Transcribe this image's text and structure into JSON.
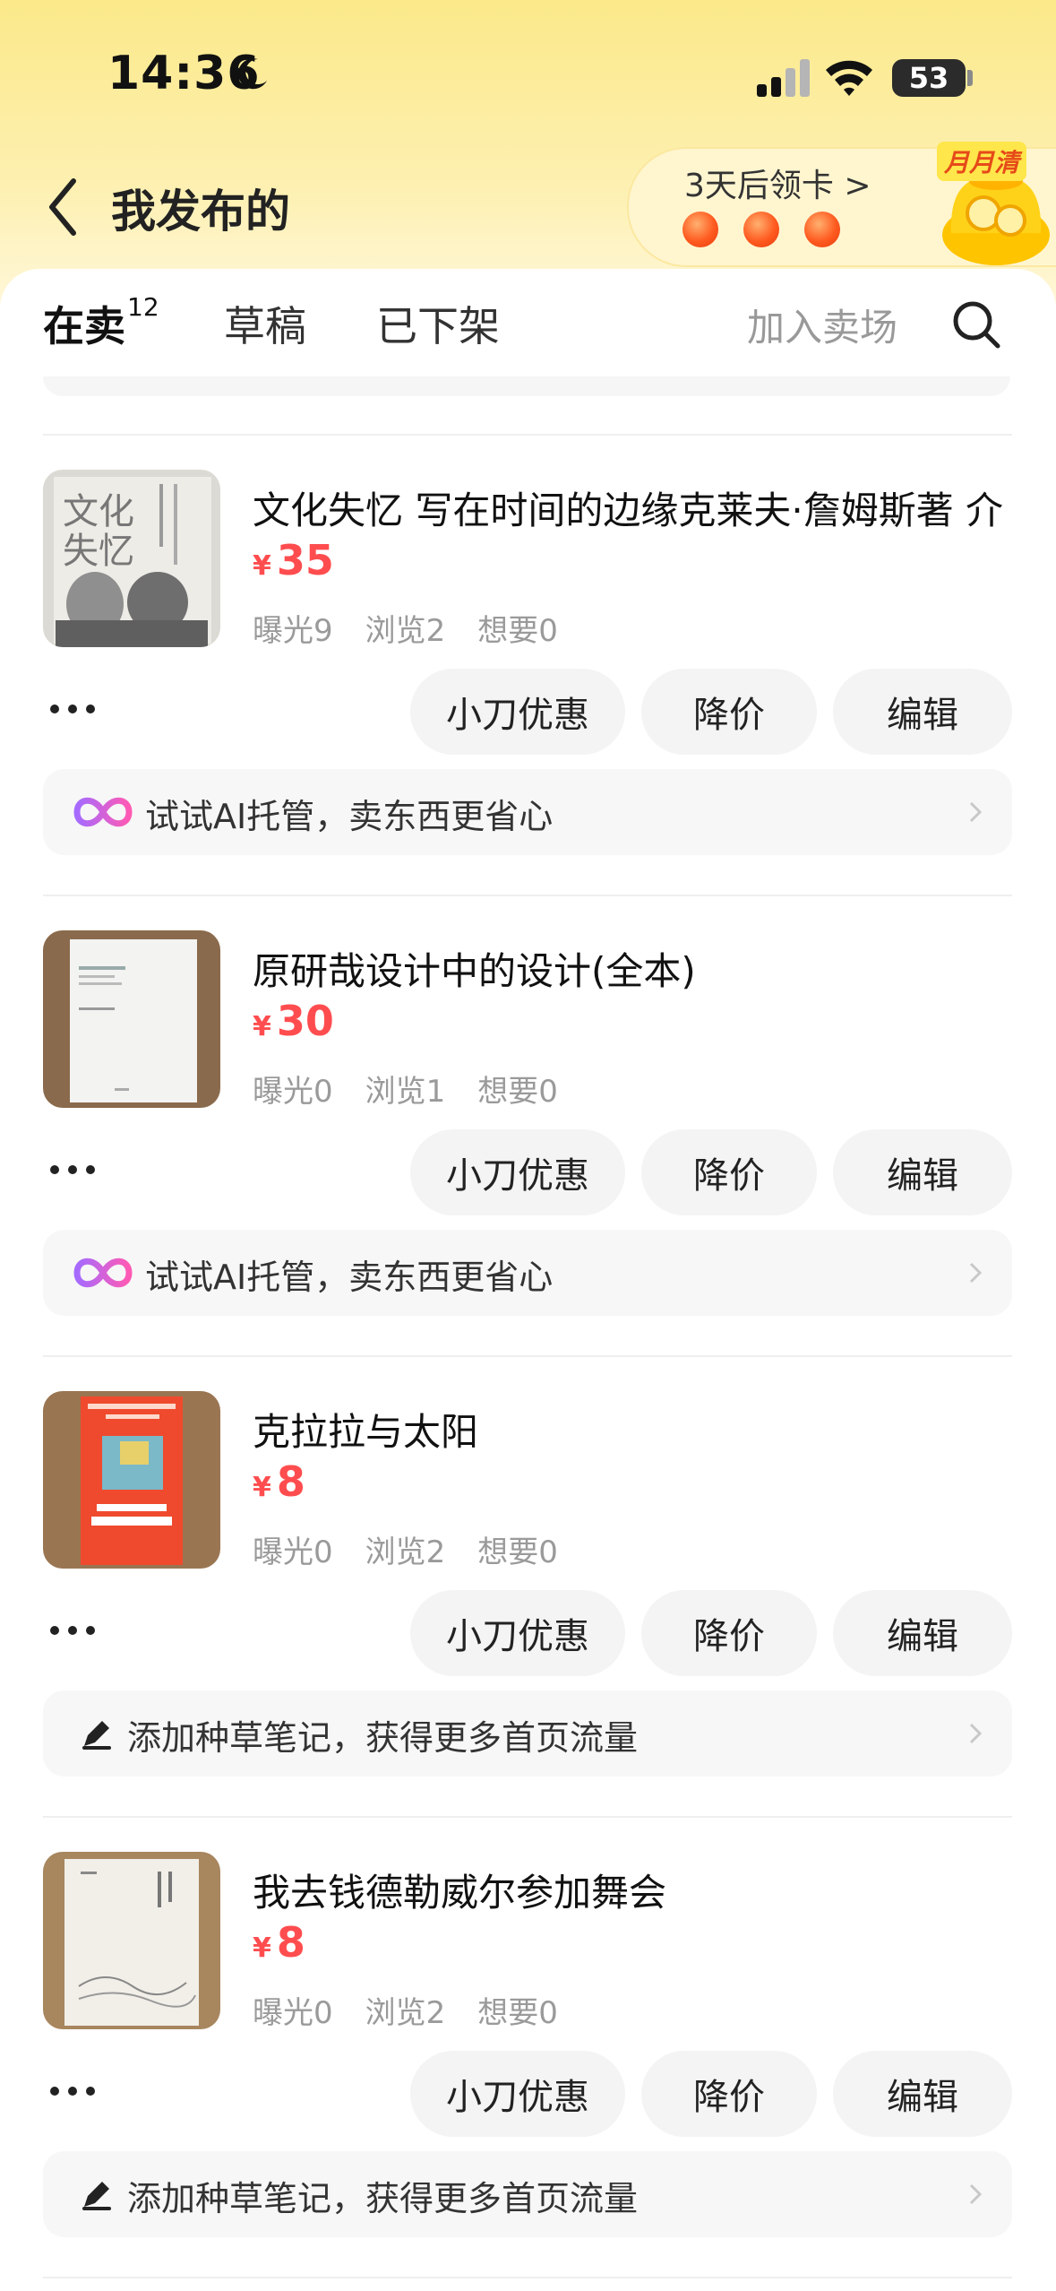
{
  "status_bar": {
    "time": "14:36",
    "battery": "53"
  },
  "header": {
    "title": "我发布的",
    "promo": {
      "text": "3天后领卡 >",
      "badge": "月月清"
    }
  },
  "tabs": {
    "active": {
      "label": "在卖",
      "count": "12"
    },
    "draft": "草稿",
    "off_shelf": "已下架",
    "join_market": "加入卖场"
  },
  "listings": [
    {
      "title": "文化失忆 写在时间的边缘克莱夫·詹姆斯著 介",
      "currency": "¥",
      "price": "35",
      "stats": {
        "exposure": "曝光9",
        "views": "浏览2",
        "wants": "想要0"
      },
      "buttons": {
        "knife": "小刀优惠",
        "reduce": "降价",
        "edit": "编辑"
      },
      "tip": "试试AI托管，卖东西更省心"
    },
    {
      "title": "原研哉设计中的设计(全本)",
      "currency": "¥",
      "price": "30",
      "stats": {
        "exposure": "曝光0",
        "views": "浏览1",
        "wants": "想要0"
      },
      "buttons": {
        "knife": "小刀优惠",
        "reduce": "降价",
        "edit": "编辑"
      },
      "tip": "试试AI托管，卖东西更省心"
    },
    {
      "title": "克拉拉与太阳",
      "currency": "¥",
      "price": "8",
      "stats": {
        "exposure": "曝光0",
        "views": "浏览2",
        "wants": "想要0"
      },
      "buttons": {
        "knife": "小刀优惠",
        "reduce": "降价",
        "edit": "编辑"
      },
      "tip": "添加种草笔记，获得更多首页流量"
    },
    {
      "title": "我去钱德勒威尔参加舞会",
      "currency": "¥",
      "price": "8",
      "stats": {
        "exposure": "曝光0",
        "views": "浏览2",
        "wants": "想要0"
      },
      "buttons": {
        "knife": "小刀优惠",
        "reduce": "降价",
        "edit": "编辑"
      },
      "tip": "添加种草笔记，获得更多首页流量"
    }
  ],
  "colors": {
    "accent_yellow": "#ffe600",
    "price_red": "#ff4d4f",
    "header_bg": "#fbe98a"
  }
}
